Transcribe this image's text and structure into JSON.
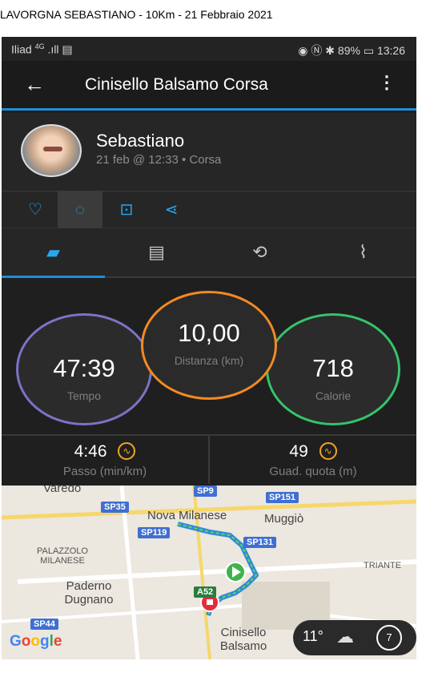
{
  "caption": "LAVORGNA SEBASTIANO  -  10Km  -  21 Febbraio 2021",
  "status_bar": {
    "carrier": "Iliad",
    "network": "4G",
    "battery": "89%",
    "time": "13:26"
  },
  "app_bar": {
    "back_icon": "arrow-left-icon",
    "title": "Cinisello Balsamo Corsa",
    "menu_icon": "more-vert-icon"
  },
  "profile": {
    "name": "Sebastiano",
    "meta": "21 feb @ 12:33 • Corsa"
  },
  "actions": [
    {
      "icon": "heart-icon"
    },
    {
      "icon": "comment-icon"
    },
    {
      "icon": "add-photo-icon"
    },
    {
      "icon": "share-icon"
    }
  ],
  "tabs": [
    {
      "icon": "overview-icon"
    },
    {
      "icon": "details-icon"
    },
    {
      "icon": "laps-icon"
    },
    {
      "icon": "charts-icon"
    }
  ],
  "stats": {
    "tempo": {
      "value": "47:39",
      "label": "Tempo",
      "color": "#7a73c9"
    },
    "distanza": {
      "value": "10,00",
      "label": "Distanza (km)",
      "color": "#f28a22"
    },
    "calorie": {
      "value": "718",
      "label": "Calorie",
      "color": "#35c46a"
    }
  },
  "metrics": {
    "passo": {
      "value": "4:46",
      "label": "Passo (min/km)"
    },
    "quota": {
      "value": "49",
      "label": "Guad. quota (m)"
    }
  },
  "map": {
    "places": [
      "Varedo",
      "Nova Milanese",
      "Muggiò",
      "PALAZZOLO MILANESE",
      "Paderno Dugnano",
      "Cinisello Balsamo",
      "TRIANTE"
    ],
    "roads": [
      "SP9",
      "SP35",
      "SP151",
      "SP119",
      "SP131",
      "A52",
      "SP44"
    ],
    "logo": "Google",
    "weather": {
      "temp": "11°",
      "wind": "7"
    }
  },
  "colors": {
    "accent": "#1f8fd6",
    "background": "#1f1f1f"
  }
}
